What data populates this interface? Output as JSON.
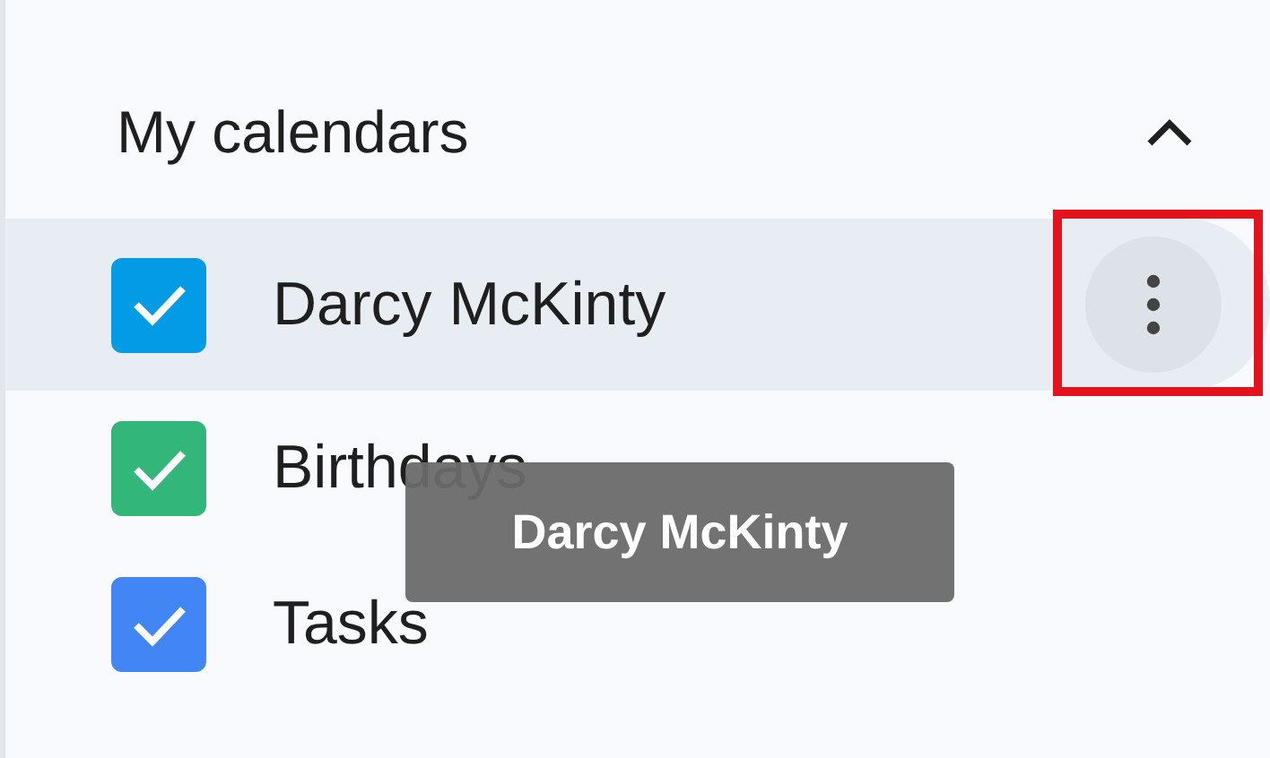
{
  "section": {
    "title": "My calendars",
    "expanded": true
  },
  "calendars": [
    {
      "name": "Darcy McKinty",
      "checked": true,
      "color": "#039be5",
      "hovered": true
    },
    {
      "name": "Birthdays",
      "checked": true,
      "color": "#33b679",
      "hovered": false
    },
    {
      "name": "Tasks",
      "checked": true,
      "color": "#4285f4",
      "hovered": false
    }
  ],
  "tooltip": {
    "text": "Darcy McKinty"
  },
  "highlight": {
    "on": true
  }
}
